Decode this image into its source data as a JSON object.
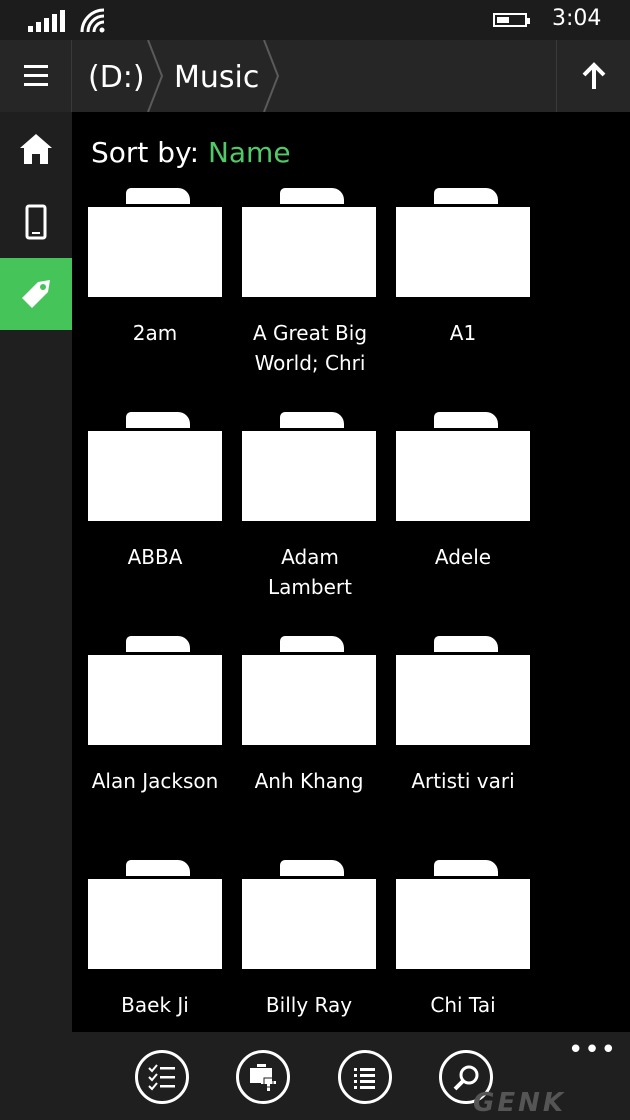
{
  "status": {
    "time": "3:04",
    "signal_bars": 4,
    "battery_level": 0.45
  },
  "header": {
    "menu_icon": "hamburger-icon",
    "breadcrumbs": [
      "(D:)",
      "Music"
    ],
    "up_icon": "up-arrow-icon"
  },
  "nav": {
    "items": [
      {
        "icon": "home-icon",
        "active": false
      },
      {
        "icon": "phone-icon",
        "active": false
      },
      {
        "icon": "tag-icon",
        "active": true
      }
    ]
  },
  "sort": {
    "label": "Sort by:",
    "value": "Name"
  },
  "folders": [
    {
      "name": "2am"
    },
    {
      "name": "A Great Big World; Chri"
    },
    {
      "name": "A1"
    },
    {
      "name": "ABBA"
    },
    {
      "name": "Adam Lambert"
    },
    {
      "name": "Adele"
    },
    {
      "name": "Alan Jackson"
    },
    {
      "name": "Anh Khang"
    },
    {
      "name": "Artisti vari"
    },
    {
      "name": "Baek Ji"
    },
    {
      "name": "Billy Ray"
    },
    {
      "name": "Chi Tai"
    }
  ],
  "appbar": {
    "buttons": [
      {
        "icon": "multi-select-icon"
      },
      {
        "icon": "new-folder-icon"
      },
      {
        "icon": "list-view-icon"
      },
      {
        "icon": "search-icon"
      }
    ],
    "more_label": "•••"
  },
  "watermark": "GENK",
  "colors": {
    "accent": "#51c968",
    "background": "#000000",
    "chrome": "#1f1f1f"
  }
}
